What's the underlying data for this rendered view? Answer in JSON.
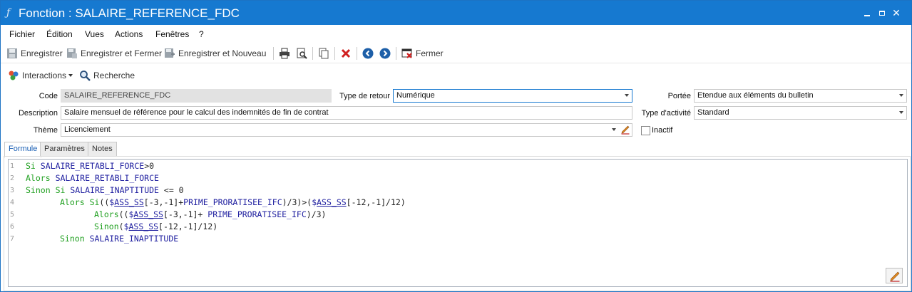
{
  "window": {
    "icon": "function-icon",
    "title": "Fonction : SALAIRE_REFERENCE_FDC",
    "controls": {
      "minimize": "minimize-icon",
      "maximize": "maximize-icon",
      "close": "close-icon"
    },
    "accent_color": "#1679d0"
  },
  "menu": {
    "items": [
      {
        "label": "Fichier"
      },
      {
        "label": "Édition"
      },
      {
        "label": "Vues"
      },
      {
        "label": "Actions"
      },
      {
        "label": "Fenêtres"
      },
      {
        "label": "?"
      }
    ]
  },
  "toolbar": {
    "save": "Enregistrer",
    "save_close": "Enregistrer et Fermer",
    "save_new": "Enregistrer et Nouveau",
    "close": "Fermer",
    "icons": [
      "save-icon",
      "save-close-icon",
      "save-new-icon",
      "print-icon",
      "print-preview-icon",
      "copy-icon",
      "delete-icon",
      "previous-icon",
      "next-icon",
      "close-window-icon"
    ]
  },
  "toolbar2": {
    "interactions": "Interactions",
    "search": "Recherche"
  },
  "form": {
    "code_label": "Code",
    "code_value": "SALAIRE_REFERENCE_FDC",
    "return_type_label": "Type de retour",
    "return_type_value": "Numérique",
    "scope_label": "Portée",
    "scope_value": "Etendue aux éléments du bulletin",
    "description_label": "Description",
    "description_value": "Salaire mensuel de référence pour le calcul des indemnités de fin de contrat",
    "activity_type_label": "Type d'activité",
    "activity_type_value": "Standard",
    "theme_label": "Thème",
    "theme_value": "Licenciement",
    "inactive_label": "Inactif",
    "inactive_checked": false
  },
  "tabs": [
    {
      "label": "Formule",
      "active": true
    },
    {
      "label": "Paramètres",
      "active": false
    },
    {
      "label": "Notes",
      "active": false
    }
  ],
  "editor": {
    "line_numbers": [
      "1",
      "2",
      "3",
      "4",
      "5",
      "6",
      "7"
    ],
    "lines": [
      "Si SALAIRE_RETABLI_FORCE>0",
      "Alors SALAIRE_RETABLI_FORCE",
      "Sinon Si SALAIRE_INAPTITUDE <= 0",
      "      Alors Si(($ASS_SS[-3,-1]+PRIME_PRORATISEE_IFC)/3)>($ASS_SS[-12,-1]/12)",
      "            Alors(($ASS_SS[-3,-1]+ PRIME_PRORATISEE_IFC)/3)",
      "            Sinon($ASS_SS[-12,-1]/12)",
      "      Sinon SALAIRE_INAPTITUDE"
    ],
    "tokens": {
      "si": "Si",
      "alors": "Alors",
      "sinon": "Sinon",
      "retabli": "SALAIRE_RETABLI_FORCE",
      "inaptitude": "SALAIRE_INAPTITUDE",
      "prime": "PRIME_PRORATISEE_IFC",
      "ass": "ASS_SS",
      "gt0": ">0",
      "le0": " <= 0"
    },
    "keyword_color": "#20a020",
    "identifier_color": "#2020a0"
  }
}
